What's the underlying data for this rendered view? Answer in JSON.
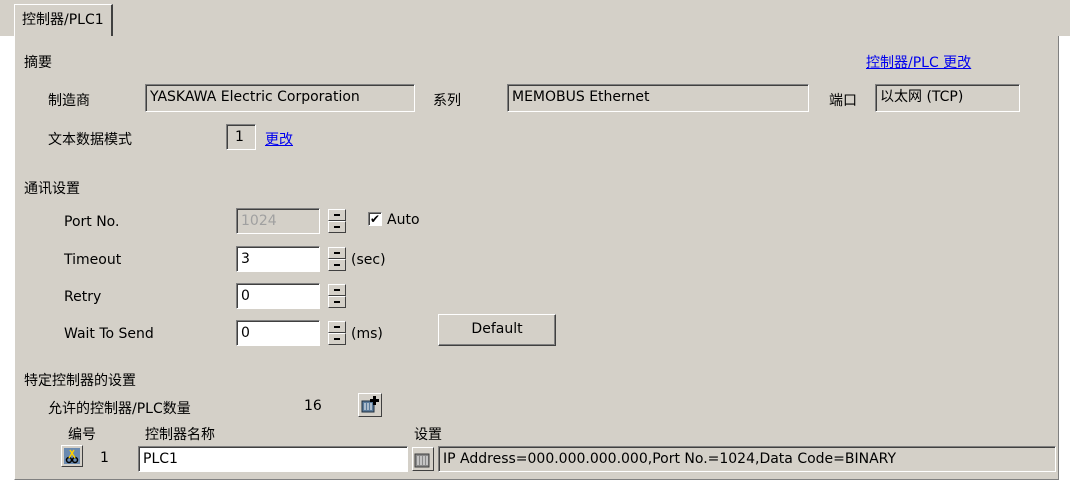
{
  "tab": {
    "label": "控制器/PLC1"
  },
  "summary": {
    "heading": "摘要",
    "change_link": "控制器/PLC 更改",
    "manufacturer_label": "制造商",
    "manufacturer_value": "YASKAWA Electric Corporation",
    "series_label": "系列",
    "series_value": "MEMOBUS Ethernet",
    "port_label": "端口",
    "port_value": "以太网 (TCP)",
    "text_mode_label": "文本数据模式",
    "text_mode_value": "1",
    "text_mode_change": "更改"
  },
  "comm": {
    "heading": "通讯设置",
    "port_no_label": "Port No.",
    "port_no_value": "1024",
    "auto_label": "Auto",
    "auto_checked": true,
    "timeout_label": "Timeout",
    "timeout_value": "3",
    "timeout_unit": "(sec)",
    "retry_label": "Retry",
    "retry_value": "0",
    "wait_label": "Wait To Send",
    "wait_value": "0",
    "wait_unit": "(ms)",
    "default_button": "Default"
  },
  "device": {
    "heading": "特定控制器的设置",
    "allowed_label": "允许的控制器/PLC数量",
    "allowed_count": "16",
    "col_number": "编号",
    "col_name": "控制器名称",
    "col_settings": "设置",
    "rows": [
      {
        "number": "1",
        "name": "PLC1",
        "settings": "IP Address=000.000.000.000,Port No.=1024,Data Code=BINARY"
      }
    ]
  },
  "colors": {
    "panel": "#d4d0c8",
    "link": "#0000ee",
    "disabled_text": "#a0a0a0"
  },
  "icons": [
    "add-device-icon",
    "settings-icon",
    "delete-icon",
    "check-icon"
  ]
}
